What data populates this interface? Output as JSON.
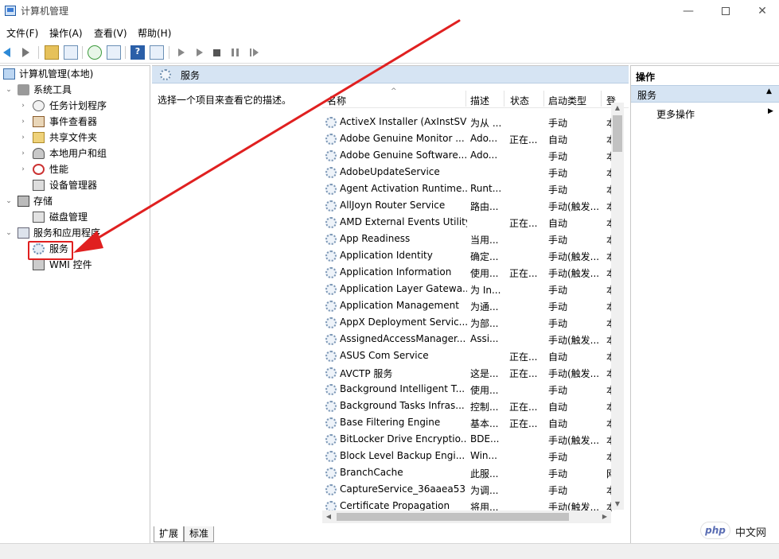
{
  "window": {
    "title": "计算机管理",
    "minimize_glyph": "—",
    "close_glyph": "✕"
  },
  "menu": {
    "items": [
      "文件(F)",
      "操作(A)",
      "查看(V)",
      "帮助(H)"
    ]
  },
  "tree": {
    "root": "计算机管理(本地)",
    "items": [
      {
        "label": "系统工具",
        "icon": "tools-icon"
      },
      {
        "label": "任务计划程序",
        "icon": "clock-icon"
      },
      {
        "label": "事件查看器",
        "icon": "event-viewer-icon"
      },
      {
        "label": "共享文件夹",
        "icon": "shared-folder-icon"
      },
      {
        "label": "本地用户和组",
        "icon": "users-icon"
      },
      {
        "label": "性能",
        "icon": "performance-icon"
      },
      {
        "label": "设备管理器",
        "icon": "device-manager-icon"
      },
      {
        "label": "存储",
        "icon": "storage-icon"
      },
      {
        "label": "磁盘管理",
        "icon": "disk-icon"
      },
      {
        "label": "服务和应用程序",
        "icon": "services-apps-icon"
      },
      {
        "label": "服务",
        "icon": "gear-icon"
      },
      {
        "label": "WMI 控件",
        "icon": "wmi-icon"
      }
    ]
  },
  "center": {
    "title": "服务",
    "description": "选择一个项目来查看它的描述。",
    "columns": {
      "name": "名称",
      "desc": "描述",
      "status": "状态",
      "startup": "启动类型",
      "login": "登"
    },
    "services": [
      {
        "name": "ActiveX Installer (AxInstSV)",
        "desc": "为从 ...",
        "status": "",
        "startup": "手动",
        "login": "本"
      },
      {
        "name": "Adobe Genuine Monitor ...",
        "desc": "Ado...",
        "status": "正在...",
        "startup": "自动",
        "login": "本"
      },
      {
        "name": "Adobe Genuine Software...",
        "desc": "Ado...",
        "status": "",
        "startup": "手动",
        "login": "本"
      },
      {
        "name": "AdobeUpdateService",
        "desc": "",
        "status": "",
        "startup": "手动",
        "login": "本"
      },
      {
        "name": "Agent Activation Runtime...",
        "desc": "Runt...",
        "status": "",
        "startup": "手动",
        "login": "本"
      },
      {
        "name": "AllJoyn Router Service",
        "desc": "路由...",
        "status": "",
        "startup": "手动(触发...",
        "login": "本"
      },
      {
        "name": "AMD External Events Utility",
        "desc": "",
        "status": "正在...",
        "startup": "自动",
        "login": "本"
      },
      {
        "name": "App Readiness",
        "desc": "当用...",
        "status": "",
        "startup": "手动",
        "login": "本"
      },
      {
        "name": "Application Identity",
        "desc": "确定...",
        "status": "",
        "startup": "手动(触发...",
        "login": "本"
      },
      {
        "name": "Application Information",
        "desc": "使用...",
        "status": "正在...",
        "startup": "手动(触发...",
        "login": "本"
      },
      {
        "name": "Application Layer Gatewa...",
        "desc": "为 In...",
        "status": "",
        "startup": "手动",
        "login": "本"
      },
      {
        "name": "Application Management",
        "desc": "为通...",
        "status": "",
        "startup": "手动",
        "login": "本"
      },
      {
        "name": "AppX Deployment Servic...",
        "desc": "为部...",
        "status": "",
        "startup": "手动",
        "login": "本"
      },
      {
        "name": "AssignedAccessManager...",
        "desc": "Assi...",
        "status": "",
        "startup": "手动(触发...",
        "login": "本"
      },
      {
        "name": "ASUS Com Service",
        "desc": "",
        "status": "正在...",
        "startup": "自动",
        "login": "本"
      },
      {
        "name": "AVCTP 服务",
        "desc": "这是...",
        "status": "正在...",
        "startup": "手动(触发...",
        "login": "本"
      },
      {
        "name": "Background Intelligent T...",
        "desc": "使用...",
        "status": "",
        "startup": "手动",
        "login": "本"
      },
      {
        "name": "Background Tasks Infras...",
        "desc": "控制...",
        "status": "正在...",
        "startup": "自动",
        "login": "本"
      },
      {
        "name": "Base Filtering Engine",
        "desc": "基本...",
        "status": "正在...",
        "startup": "自动",
        "login": "本"
      },
      {
        "name": "BitLocker Drive Encryptio...",
        "desc": "BDE...",
        "status": "",
        "startup": "手动(触发...",
        "login": "本"
      },
      {
        "name": "Block Level Backup Engi...",
        "desc": "Win...",
        "status": "",
        "startup": "手动",
        "login": "本"
      },
      {
        "name": "BranchCache",
        "desc": "此服...",
        "status": "",
        "startup": "手动",
        "login": "网"
      },
      {
        "name": "CaptureService_36aaea53",
        "desc": "为调...",
        "status": "",
        "startup": "手动",
        "login": "本"
      },
      {
        "name": "Certificate Propagation",
        "desc": "将用...",
        "status": "",
        "startup": "手动(触发...",
        "login": "本"
      }
    ],
    "tabs": [
      "扩展",
      "标准"
    ]
  },
  "actions": {
    "title": "操作",
    "section": "服务",
    "more": "更多操作"
  },
  "watermark": {
    "logo": "php",
    "site": "中文网"
  },
  "colors": {
    "annotation_red": "#e02020",
    "header_blue": "#d6e4f3"
  }
}
